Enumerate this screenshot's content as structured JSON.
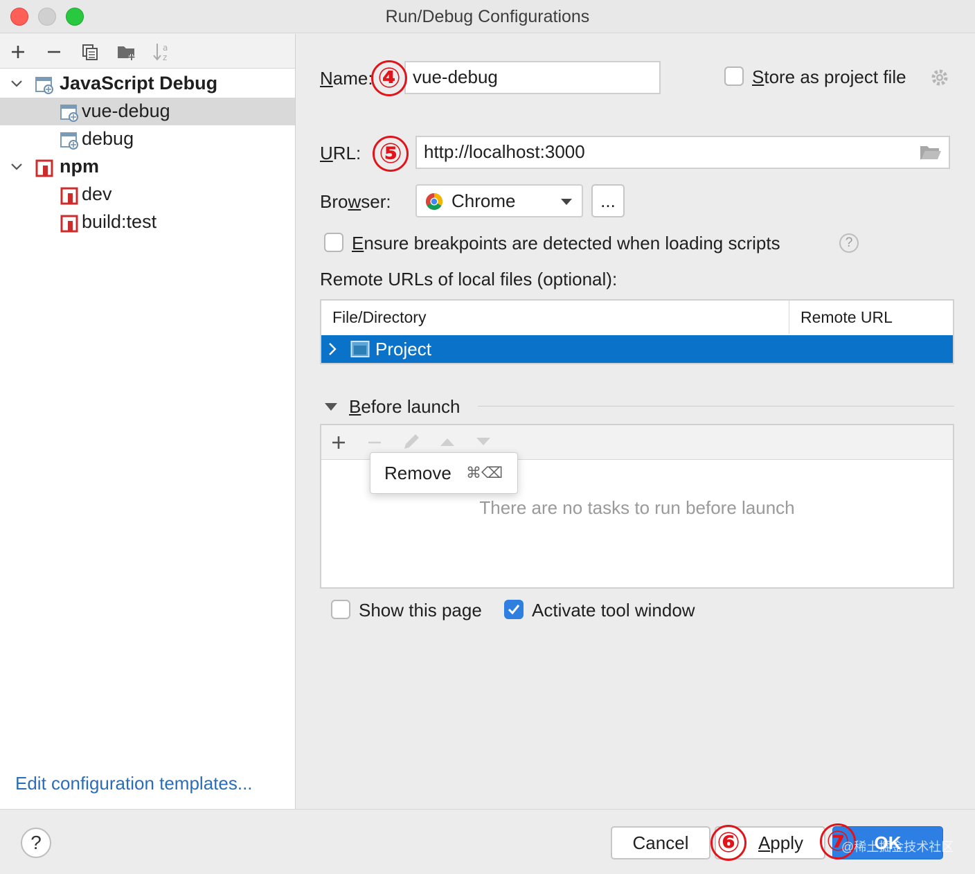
{
  "window": {
    "title": "Run/Debug Configurations"
  },
  "tree": {
    "groups": [
      {
        "label": "JavaScript Debug",
        "items": [
          {
            "label": "vue-debug",
            "selected": true
          },
          {
            "label": "debug"
          }
        ]
      },
      {
        "label": "npm",
        "items": [
          {
            "label": "dev"
          },
          {
            "label": "build:test"
          }
        ]
      }
    ],
    "edit_templates": "Edit configuration templates..."
  },
  "form": {
    "name_label_u": "N",
    "name_label_rest": "ame:",
    "name_value": "vue-debug",
    "store_u": "S",
    "store_rest": "tore as project file",
    "url_label_u": "U",
    "url_label_rest": "RL:",
    "url_value": "http://localhost:3000",
    "browser_label_a": "Bro",
    "browser_label_u": "w",
    "browser_label_b": "ser:",
    "browser_value": "Chrome",
    "browse_button": "...",
    "ensure_u": "E",
    "ensure_rest": "nsure breakpoints are detected when loading scripts",
    "help_glyph": "?",
    "remote_urls_label": "Remote URLs of local files (optional):",
    "table": {
      "columns": [
        "File/Directory",
        "Remote URL"
      ],
      "rows": [
        {
          "name": "Project"
        }
      ]
    }
  },
  "before_launch": {
    "title_u": "B",
    "title_rest": "efore launch",
    "empty": "There are no tasks to run before launch",
    "popup_label": "Remove",
    "popup_shortcut": "⌘⌫",
    "show_page": "Show this page",
    "activate_window": "Activate tool window"
  },
  "annotations": [
    "④",
    "⑤",
    "⑥",
    "⑦"
  ],
  "buttons": {
    "help": "?",
    "cancel": "Cancel",
    "apply_u": "A",
    "apply_rest": "pply",
    "ok": "OK"
  },
  "watermark": "@稀土掘金技术社区",
  "colors": {
    "selection": "#0a72c8",
    "accent": "#2d7fe3",
    "annotation": "#e0141b",
    "link": "#2a6db8",
    "npm": "#cb2d2d"
  }
}
